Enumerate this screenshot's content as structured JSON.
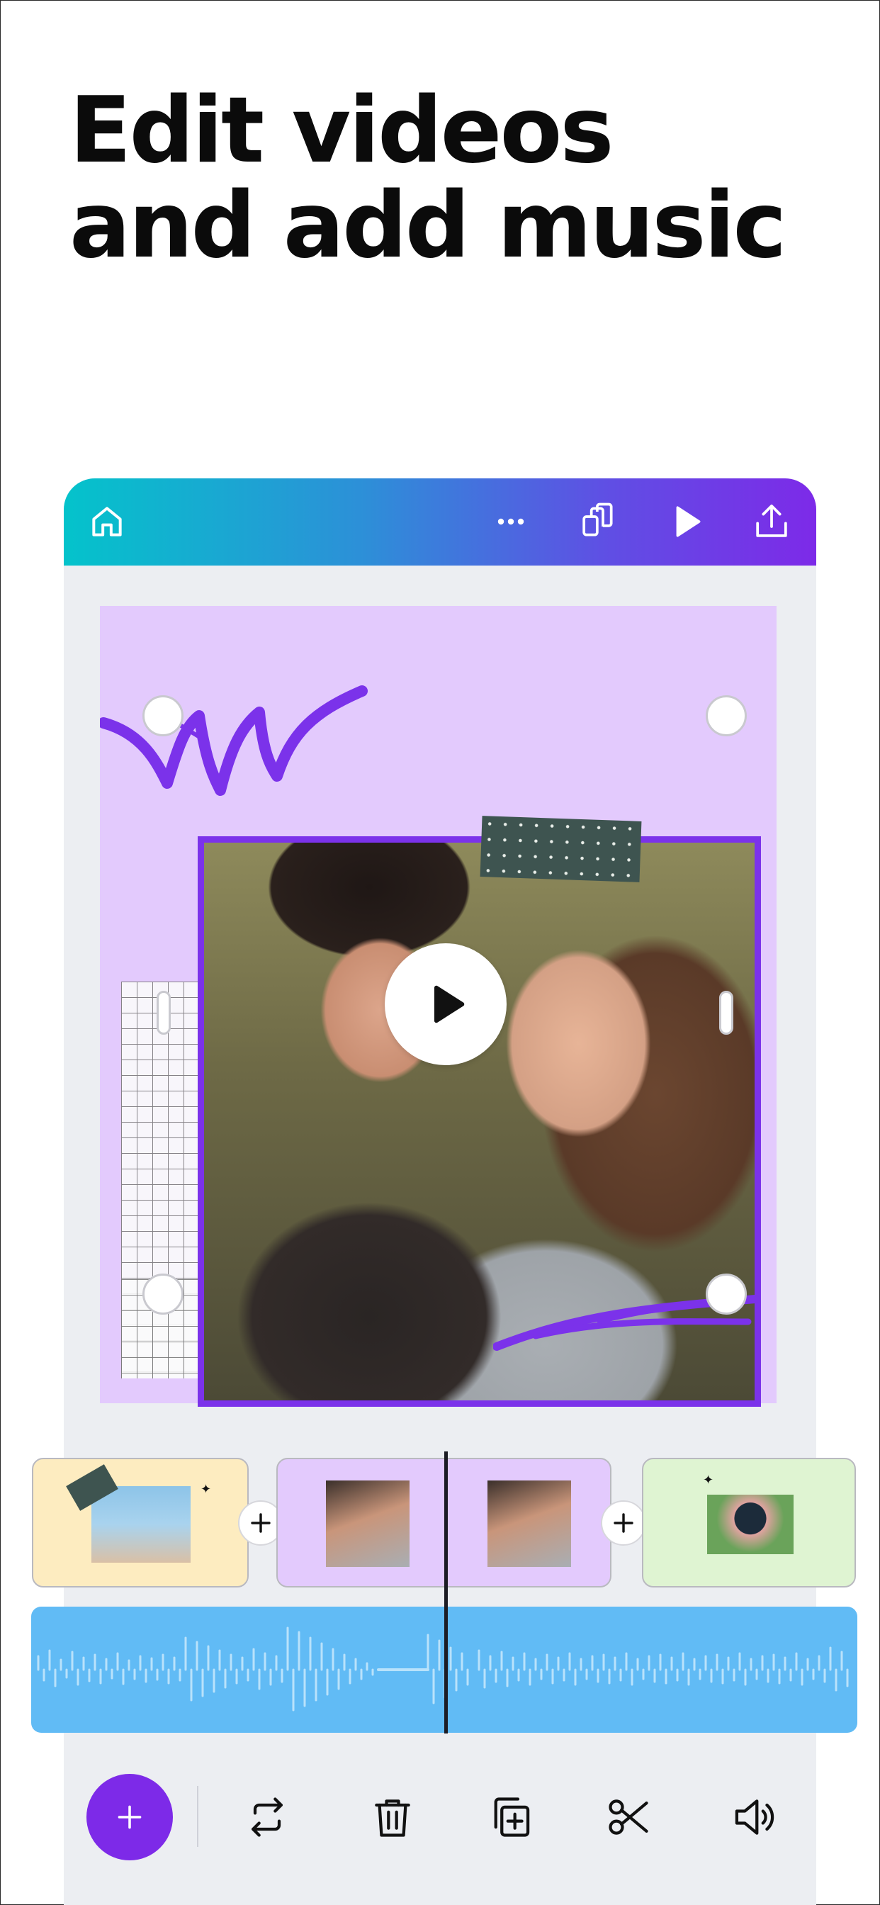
{
  "headline": {
    "line1": "Edit videos",
    "line2": "and add music"
  },
  "toolbar_top": {
    "icons": [
      "home-icon",
      "more-icon",
      "pages-icon",
      "play-icon",
      "share-icon"
    ]
  },
  "timeline": {
    "clips": [
      {
        "name": "clip-1",
        "color": "#fdecc0"
      },
      {
        "name": "clip-2",
        "color": "#e3cafd"
      },
      {
        "name": "clip-3",
        "color": "#e3cafd"
      },
      {
        "name": "clip-4",
        "color": "#dff4d2"
      }
    ],
    "audio_color": "#61bbf5"
  },
  "toolbar_bottom": {
    "icons": [
      "add-icon",
      "replace-icon",
      "delete-icon",
      "duplicate-icon",
      "split-icon",
      "volume-icon"
    ]
  },
  "colors": {
    "accent": "#7d2ae8",
    "canvas_bg": "#e3cafd",
    "header_start": "#04c3cb",
    "header_end": "#7d2ae8"
  }
}
